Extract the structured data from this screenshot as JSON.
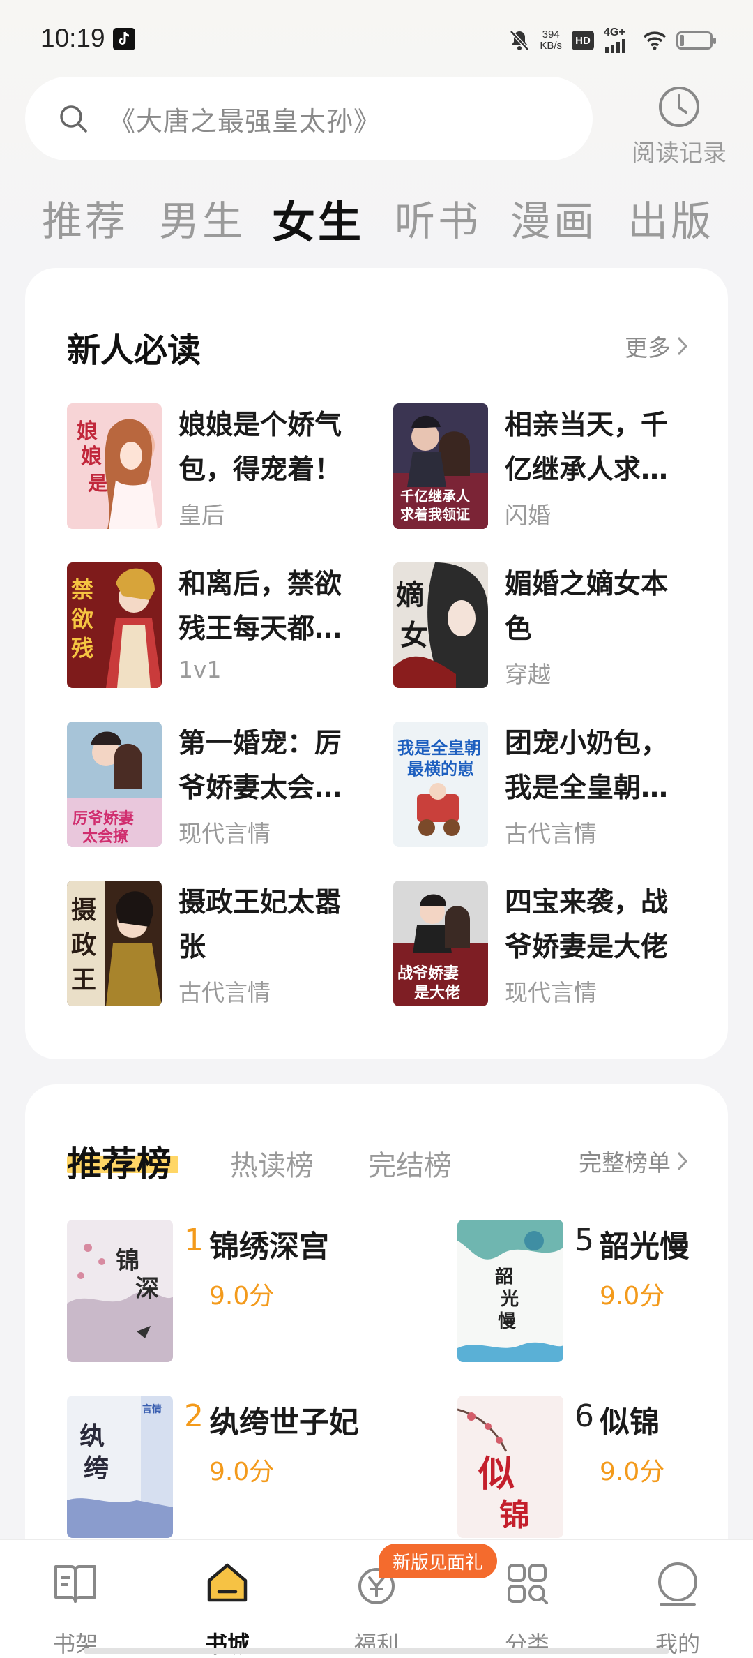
{
  "status_bar": {
    "time": "10:19",
    "speed_value": "394",
    "speed_unit": "KB/s",
    "hd": "HD",
    "network": "4G+",
    "battery_percent": 15
  },
  "search": {
    "placeholder": "《大唐之最强皇太孙》",
    "history_label": "阅读记录"
  },
  "tabs": [
    {
      "label": "推荐"
    },
    {
      "label": "男生"
    },
    {
      "label": "女生"
    },
    {
      "label": "听书"
    },
    {
      "label": "漫画"
    },
    {
      "label": "出版"
    }
  ],
  "active_tab": "女生",
  "new_reader": {
    "title": "新人必读",
    "more": "更多",
    "books": [
      {
        "title": "娘娘是个娇气包，得宠着！",
        "tag": "皇后"
      },
      {
        "title": "相亲当天，千亿继承人求…",
        "tag": "闪婚"
      },
      {
        "title": "和离后，禁欲残王每天都…",
        "tag": "1v1"
      },
      {
        "title": "媚婚之嫡女本色",
        "tag": "穿越"
      },
      {
        "title": "第一婚宠：厉爷娇妻太会…",
        "tag": "现代言情"
      },
      {
        "title": "团宠小奶包，我是全皇朝…",
        "tag": "古代言情"
      },
      {
        "title": "摄政王妃太嚣张",
        "tag": "古代言情"
      },
      {
        "title": "四宝来袭，战爷娇妻是大佬",
        "tag": "现代言情"
      }
    ]
  },
  "ranking": {
    "tabs": [
      "推荐榜",
      "热读榜",
      "完结榜"
    ],
    "full_list": "完整榜单",
    "books": [
      {
        "rank": "1",
        "title": "锦绣深宫",
        "score": "9.0分"
      },
      {
        "rank": "5",
        "title": "韶光慢",
        "score": "9.0分"
      },
      {
        "rank": "2",
        "title": "纨绔世子妃",
        "score": "9.0分"
      },
      {
        "rank": "6",
        "title": "似锦",
        "score": "9.0分"
      }
    ]
  },
  "bottom_nav": {
    "items": [
      {
        "label": "书架",
        "icon": "bookshelf-icon"
      },
      {
        "label": "书城",
        "icon": "bookstore-icon"
      },
      {
        "label": "福利",
        "icon": "welfare-icon"
      },
      {
        "label": "分类",
        "icon": "category-icon"
      },
      {
        "label": "我的",
        "icon": "profile-icon"
      }
    ],
    "badge": "新版见面礼"
  },
  "colors": {
    "accent": "#f39a1b",
    "highlight": "#ffd666",
    "badge": "#f46b2d",
    "active_nav": "#f6c244"
  }
}
